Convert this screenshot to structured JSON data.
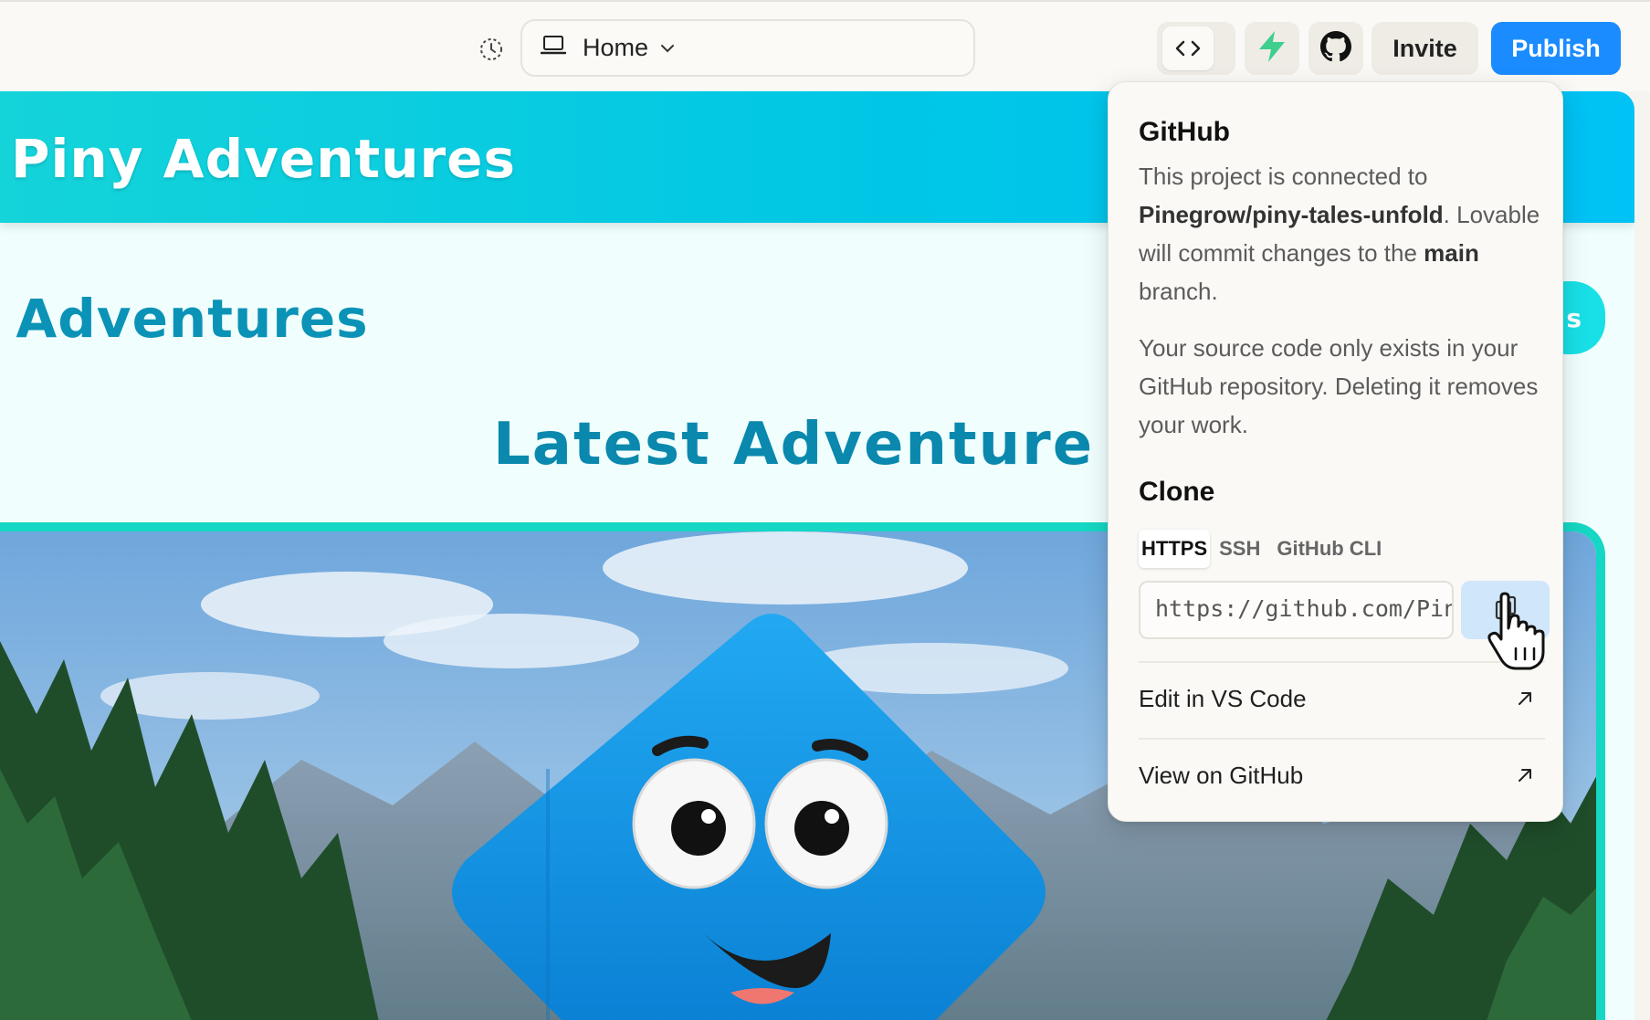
{
  "toolbar": {
    "history_icon": "history-icon",
    "device_icon": "laptop-icon",
    "route": "Home",
    "code_icon": "code-icon",
    "supabase_icon": "bolt-icon",
    "github_icon": "github-icon",
    "invite_label": "Invite",
    "publish_label": "Publish",
    "publish_color": "#1a8cff"
  },
  "preview": {
    "site_title": "Piny Adventures",
    "hero_heading": ": Adventures",
    "hero_cta_fragment": "s",
    "section_heading": "Latest Adventure",
    "header_color": "#14d3d9",
    "accent_color": "#16d7c3"
  },
  "github_popover": {
    "title": "GitHub",
    "connected_prefix": "This project is connected to",
    "repo": "Pinegrow/piny-tales-unfold",
    "commit_prefix": ". Lovable will commit changes to the",
    "branch": "main",
    "commit_suffix": "branch.",
    "warning": "Your source code only exists in your GitHub repository. Deleting it removes your work.",
    "clone_title": "Clone",
    "tabs": [
      "HTTPS",
      "SSH",
      "GitHub CLI"
    ],
    "active_tab": "HTTPS",
    "clone_url": "https://github.com/Pinegrow/piny-tales-unfold.git",
    "copy_icon": "copy-icon",
    "links": [
      {
        "label": "Edit in VS Code",
        "icon": "external-arrow-icon"
      },
      {
        "label": "View on GitHub",
        "icon": "external-arrow-icon"
      }
    ]
  }
}
